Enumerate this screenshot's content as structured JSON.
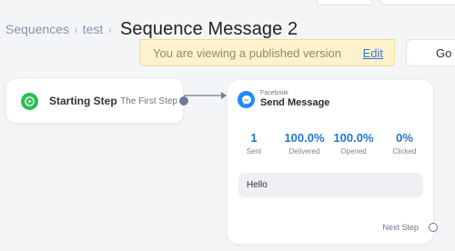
{
  "breadcrumb": {
    "items": [
      "Sequences",
      "test"
    ],
    "separator": "›",
    "current": "Sequence Message 2"
  },
  "banner": {
    "text": "You are viewing a published version",
    "link": "Edit",
    "bg_color": "#fdf2cb",
    "link_color": "#2e7bd6"
  },
  "go_button": {
    "label": "Go"
  },
  "start_step": {
    "icon": "play-icon",
    "title": "Starting Step",
    "next_label": "The First Step",
    "icon_color": "#2bbd53"
  },
  "message_step": {
    "icon": "messenger-icon",
    "channel": "Facebook",
    "title": "Send Message",
    "stats": [
      {
        "value": "1",
        "label": "Sent"
      },
      {
        "value": "100.0%",
        "label": "Delivered"
      },
      {
        "value": "100.0%",
        "label": "Opened"
      },
      {
        "value": "0%",
        "label": "Clicked"
      }
    ],
    "preview_text": "Hello",
    "next_step_label": "Next Step",
    "stat_color": "#2277cc"
  }
}
